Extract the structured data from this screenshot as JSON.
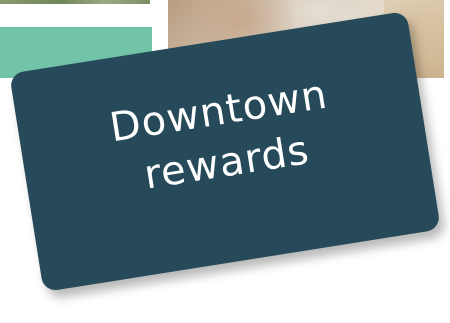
{
  "card": {
    "title_line1": "Downtown",
    "title_line2": "rewards"
  },
  "colors": {
    "card_background": "#264a59",
    "card_text": "#ffffff",
    "teal_block": "#72c4a8",
    "page_background": "#ffffff"
  },
  "images": {
    "top_left": "landscape-photo",
    "top_right": "person-with-blanket-photo"
  }
}
